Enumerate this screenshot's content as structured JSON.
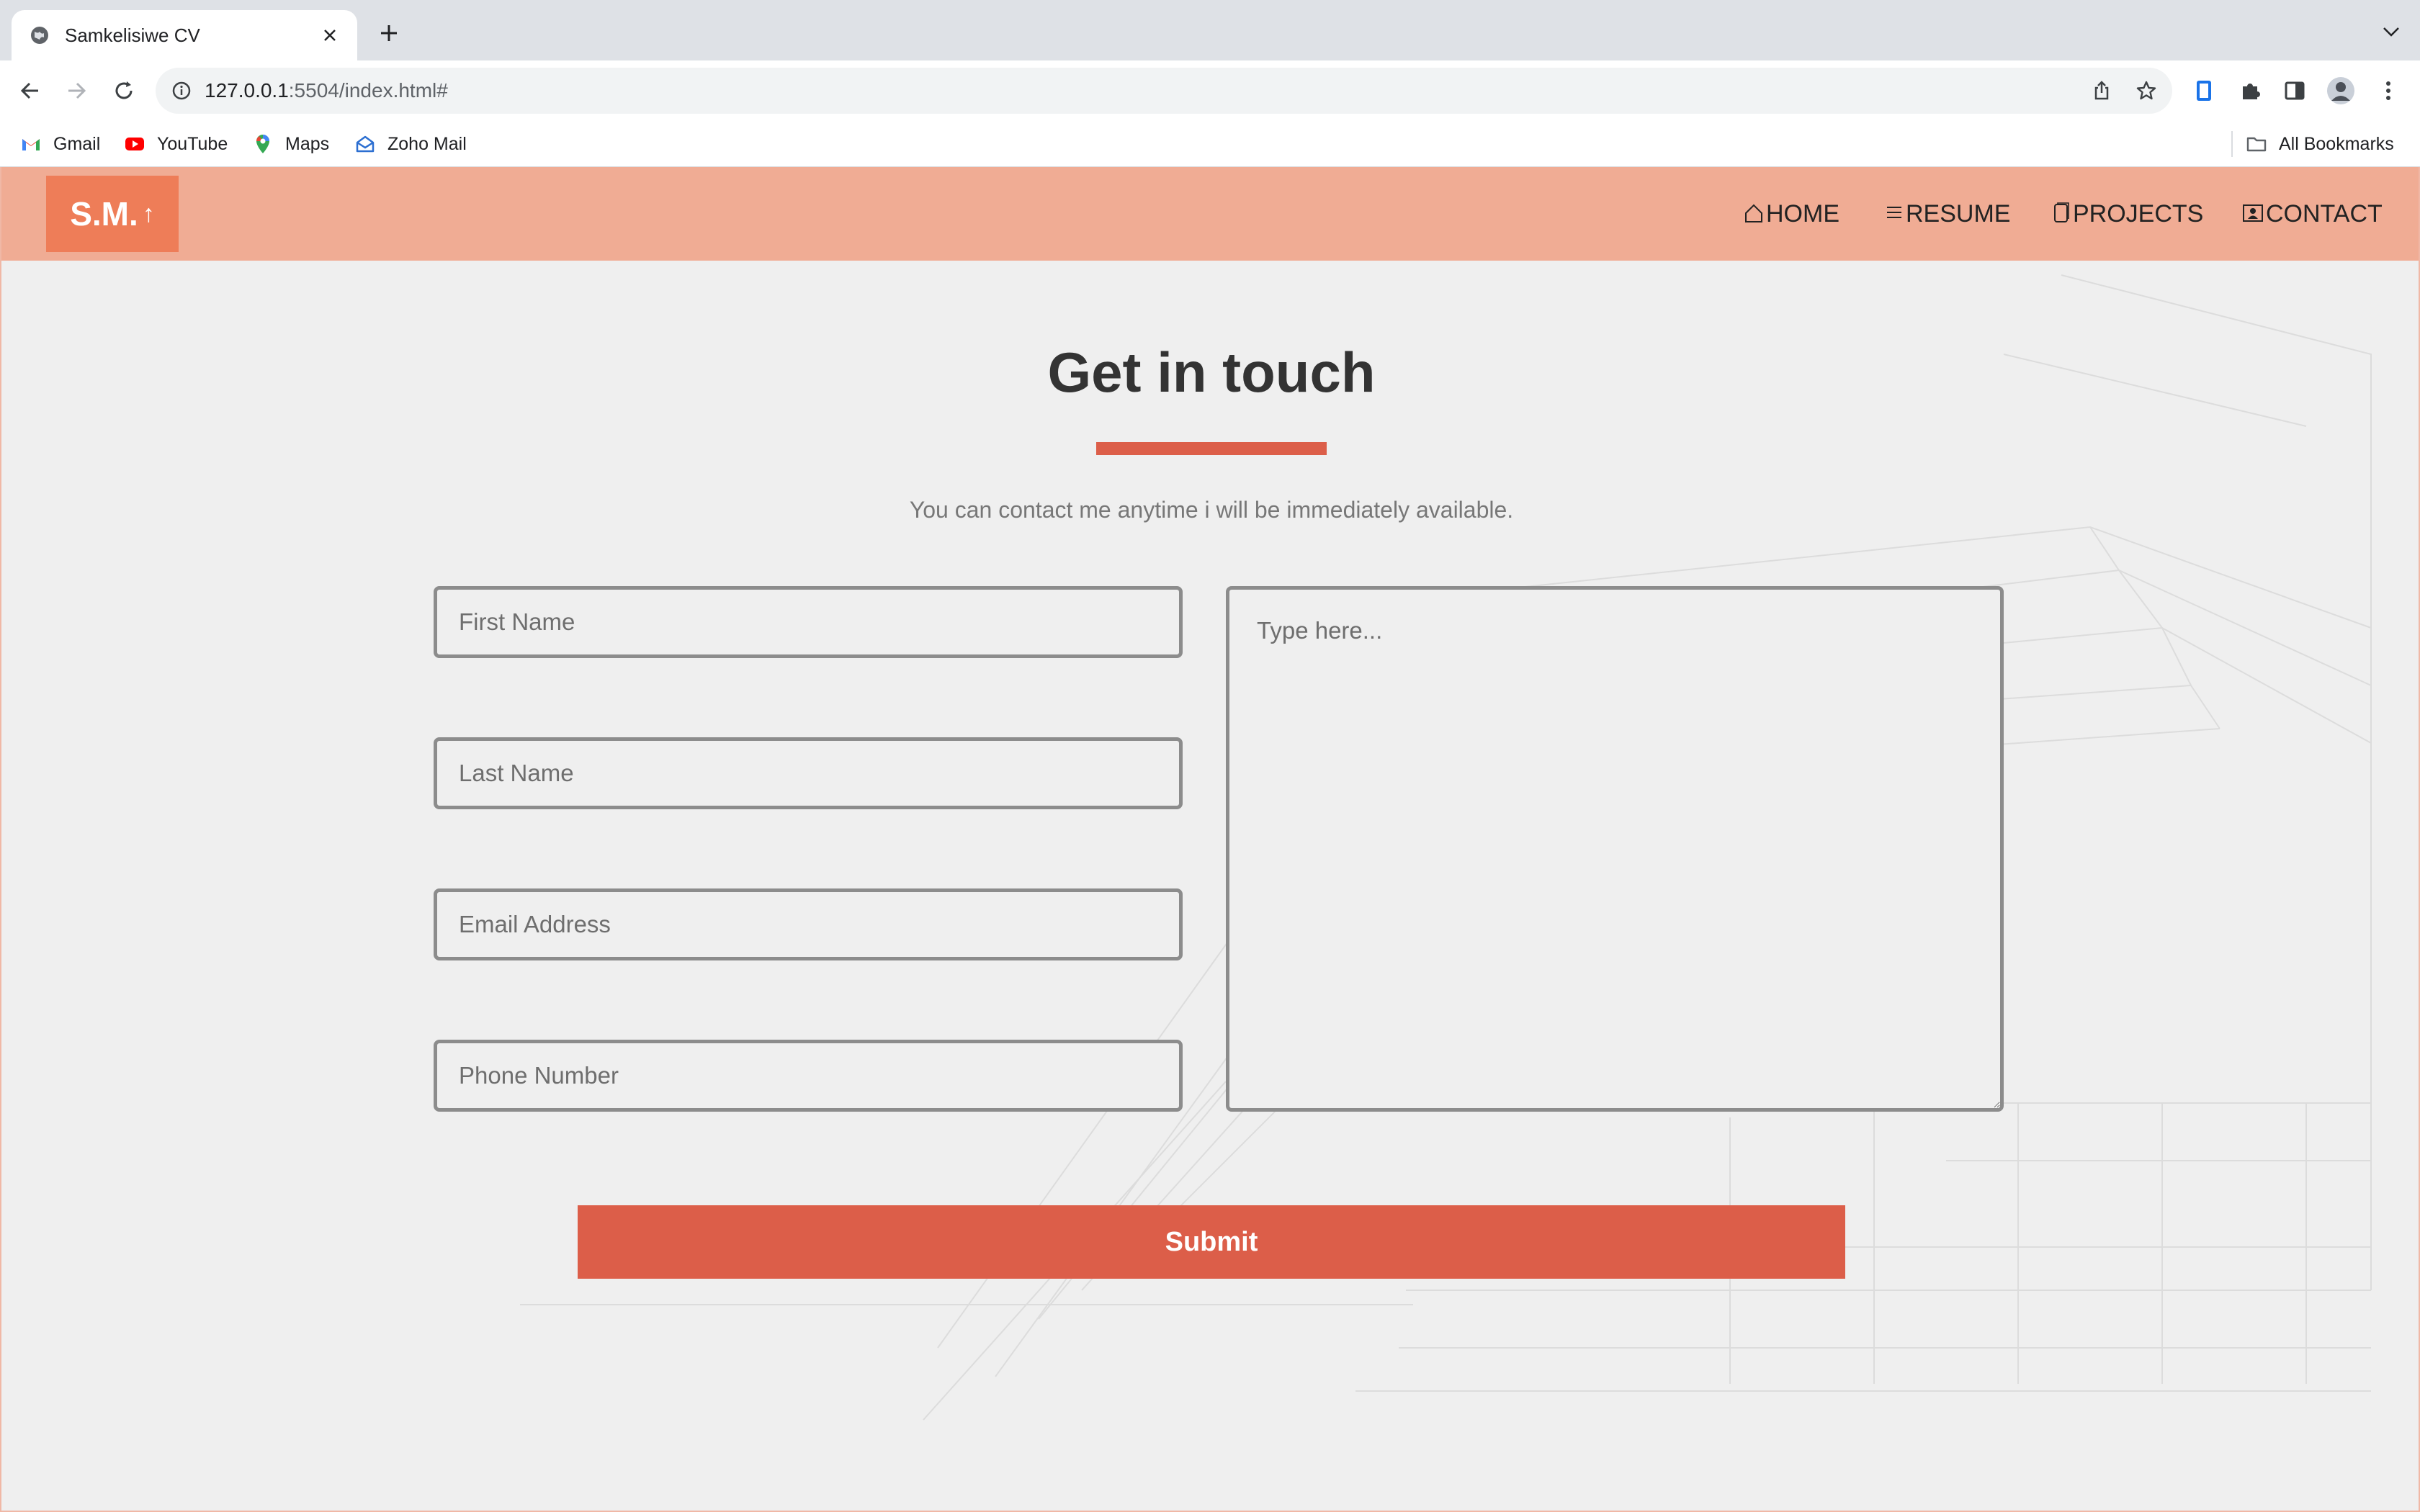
{
  "browser": {
    "tab": {
      "title": "Samkelisiwe CV"
    },
    "address": {
      "host": "127.0.0.1",
      "rest": ":5504/index.html#"
    },
    "bookmarks": [
      {
        "label": "Gmail",
        "icon": "gmail-icon"
      },
      {
        "label": "YouTube",
        "icon": "youtube-icon"
      },
      {
        "label": "Maps",
        "icon": "maps-icon"
      },
      {
        "label": "Zoho Mail",
        "icon": "zoho-mail-icon"
      }
    ],
    "all_bookmarks": "All Bookmarks"
  },
  "site": {
    "logo": {
      "text": "S.M.",
      "arrow": "↑"
    },
    "nav": [
      {
        "label": "HOME",
        "icon": "home-icon"
      },
      {
        "label": "RESUME",
        "icon": "menu-lines-icon"
      },
      {
        "label": "PROJECTS",
        "icon": "document-icon"
      },
      {
        "label": "CONTACT",
        "icon": "contact-card-icon"
      }
    ],
    "colors": {
      "navbar": "#f0ac94",
      "logo_bg": "#ee7d58",
      "accent": "#dc5e49"
    }
  },
  "contact": {
    "heading": "Get in touch",
    "subtitle": "You can contact me anytime i will be immediately available.",
    "fields": {
      "first_name": "First Name",
      "last_name": "Last Name",
      "email": "Email Address",
      "phone": "Phone Number",
      "message": "Type here..."
    },
    "submit": "Submit"
  }
}
